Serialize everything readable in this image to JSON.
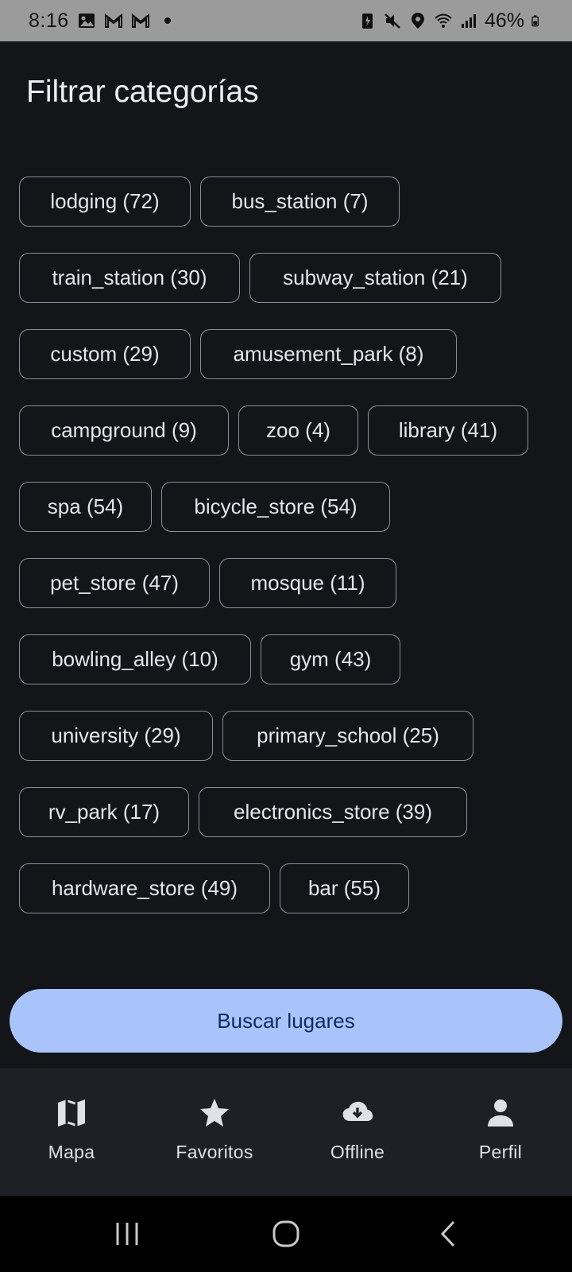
{
  "status_bar": {
    "time": "8:16",
    "battery": "46%",
    "left_icons": [
      "gallery-icon",
      "gmail-icon",
      "gmail-icon",
      "dot-icon"
    ],
    "right_icons": [
      "battery-saver-icon",
      "mute-icon",
      "location-icon",
      "wifi-icon",
      "signal-icon",
      "battery-icon"
    ]
  },
  "page": {
    "title": "Filtrar categorías"
  },
  "categories": [
    "lodging (72)",
    "bus_station (7)",
    "train_station (30)",
    "subway_station (21)",
    "custom (29)",
    "amusement_park (8)",
    "campground (9)",
    "zoo (4)",
    "library (41)",
    "spa (54)",
    "bicycle_store (54)",
    "pet_store (47)",
    "mosque (11)",
    "bowling_alley (10)",
    "gym (43)",
    "university (29)",
    "primary_school (25)",
    "rv_park (17)",
    "electronics_store (39)",
    "hardware_store (49)",
    "bar (55)"
  ],
  "search_button": {
    "label": "Buscar lugares"
  },
  "bottom_nav": {
    "items": [
      {
        "label": "Mapa",
        "icon": "map-icon"
      },
      {
        "label": "Favoritos",
        "icon": "star-icon"
      },
      {
        "label": "Offline",
        "icon": "cloud-download-icon"
      },
      {
        "label": "Perfil",
        "icon": "person-icon"
      }
    ]
  },
  "colors": {
    "background": "#131519",
    "chip_border": "#8a8d96",
    "button_bg": "#a8c4fb",
    "button_text": "#0f2a5e",
    "nav_bg": "#1e2026"
  }
}
